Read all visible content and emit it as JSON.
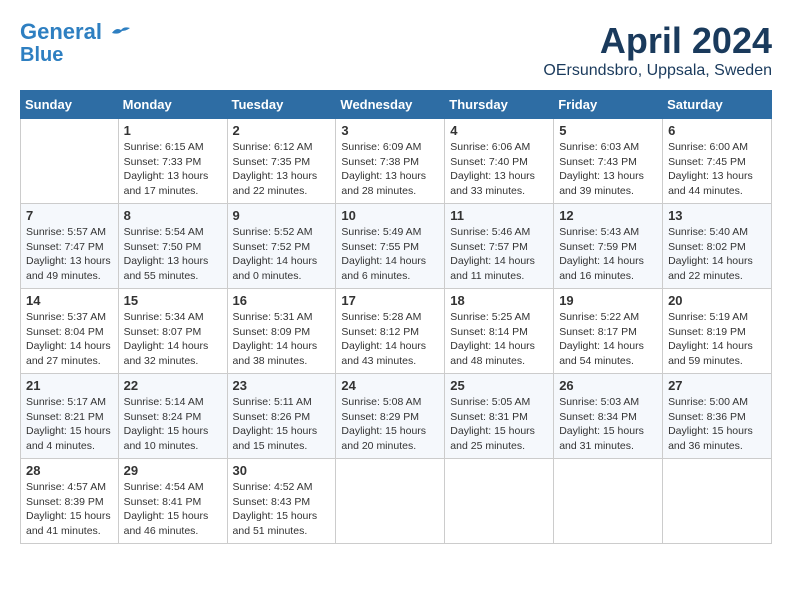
{
  "header": {
    "logo_line1": "General",
    "logo_line2": "Blue",
    "title": "April 2024",
    "location": "OErsundsbro, Uppsala, Sweden"
  },
  "calendar": {
    "weekdays": [
      "Sunday",
      "Monday",
      "Tuesday",
      "Wednesday",
      "Thursday",
      "Friday",
      "Saturday"
    ],
    "weeks": [
      [
        {
          "day": "",
          "info": ""
        },
        {
          "day": "1",
          "info": "Sunrise: 6:15 AM\nSunset: 7:33 PM\nDaylight: 13 hours\nand 17 minutes."
        },
        {
          "day": "2",
          "info": "Sunrise: 6:12 AM\nSunset: 7:35 PM\nDaylight: 13 hours\nand 22 minutes."
        },
        {
          "day": "3",
          "info": "Sunrise: 6:09 AM\nSunset: 7:38 PM\nDaylight: 13 hours\nand 28 minutes."
        },
        {
          "day": "4",
          "info": "Sunrise: 6:06 AM\nSunset: 7:40 PM\nDaylight: 13 hours\nand 33 minutes."
        },
        {
          "day": "5",
          "info": "Sunrise: 6:03 AM\nSunset: 7:43 PM\nDaylight: 13 hours\nand 39 minutes."
        },
        {
          "day": "6",
          "info": "Sunrise: 6:00 AM\nSunset: 7:45 PM\nDaylight: 13 hours\nand 44 minutes."
        }
      ],
      [
        {
          "day": "7",
          "info": "Sunrise: 5:57 AM\nSunset: 7:47 PM\nDaylight: 13 hours\nand 49 minutes."
        },
        {
          "day": "8",
          "info": "Sunrise: 5:54 AM\nSunset: 7:50 PM\nDaylight: 13 hours\nand 55 minutes."
        },
        {
          "day": "9",
          "info": "Sunrise: 5:52 AM\nSunset: 7:52 PM\nDaylight: 14 hours\nand 0 minutes."
        },
        {
          "day": "10",
          "info": "Sunrise: 5:49 AM\nSunset: 7:55 PM\nDaylight: 14 hours\nand 6 minutes."
        },
        {
          "day": "11",
          "info": "Sunrise: 5:46 AM\nSunset: 7:57 PM\nDaylight: 14 hours\nand 11 minutes."
        },
        {
          "day": "12",
          "info": "Sunrise: 5:43 AM\nSunset: 7:59 PM\nDaylight: 14 hours\nand 16 minutes."
        },
        {
          "day": "13",
          "info": "Sunrise: 5:40 AM\nSunset: 8:02 PM\nDaylight: 14 hours\nand 22 minutes."
        }
      ],
      [
        {
          "day": "14",
          "info": "Sunrise: 5:37 AM\nSunset: 8:04 PM\nDaylight: 14 hours\nand 27 minutes."
        },
        {
          "day": "15",
          "info": "Sunrise: 5:34 AM\nSunset: 8:07 PM\nDaylight: 14 hours\nand 32 minutes."
        },
        {
          "day": "16",
          "info": "Sunrise: 5:31 AM\nSunset: 8:09 PM\nDaylight: 14 hours\nand 38 minutes."
        },
        {
          "day": "17",
          "info": "Sunrise: 5:28 AM\nSunset: 8:12 PM\nDaylight: 14 hours\nand 43 minutes."
        },
        {
          "day": "18",
          "info": "Sunrise: 5:25 AM\nSunset: 8:14 PM\nDaylight: 14 hours\nand 48 minutes."
        },
        {
          "day": "19",
          "info": "Sunrise: 5:22 AM\nSunset: 8:17 PM\nDaylight: 14 hours\nand 54 minutes."
        },
        {
          "day": "20",
          "info": "Sunrise: 5:19 AM\nSunset: 8:19 PM\nDaylight: 14 hours\nand 59 minutes."
        }
      ],
      [
        {
          "day": "21",
          "info": "Sunrise: 5:17 AM\nSunset: 8:21 PM\nDaylight: 15 hours\nand 4 minutes."
        },
        {
          "day": "22",
          "info": "Sunrise: 5:14 AM\nSunset: 8:24 PM\nDaylight: 15 hours\nand 10 minutes."
        },
        {
          "day": "23",
          "info": "Sunrise: 5:11 AM\nSunset: 8:26 PM\nDaylight: 15 hours\nand 15 minutes."
        },
        {
          "day": "24",
          "info": "Sunrise: 5:08 AM\nSunset: 8:29 PM\nDaylight: 15 hours\nand 20 minutes."
        },
        {
          "day": "25",
          "info": "Sunrise: 5:05 AM\nSunset: 8:31 PM\nDaylight: 15 hours\nand 25 minutes."
        },
        {
          "day": "26",
          "info": "Sunrise: 5:03 AM\nSunset: 8:34 PM\nDaylight: 15 hours\nand 31 minutes."
        },
        {
          "day": "27",
          "info": "Sunrise: 5:00 AM\nSunset: 8:36 PM\nDaylight: 15 hours\nand 36 minutes."
        }
      ],
      [
        {
          "day": "28",
          "info": "Sunrise: 4:57 AM\nSunset: 8:39 PM\nDaylight: 15 hours\nand 41 minutes."
        },
        {
          "day": "29",
          "info": "Sunrise: 4:54 AM\nSunset: 8:41 PM\nDaylight: 15 hours\nand 46 minutes."
        },
        {
          "day": "30",
          "info": "Sunrise: 4:52 AM\nSunset: 8:43 PM\nDaylight: 15 hours\nand 51 minutes."
        },
        {
          "day": "",
          "info": ""
        },
        {
          "day": "",
          "info": ""
        },
        {
          "day": "",
          "info": ""
        },
        {
          "day": "",
          "info": ""
        }
      ]
    ]
  }
}
